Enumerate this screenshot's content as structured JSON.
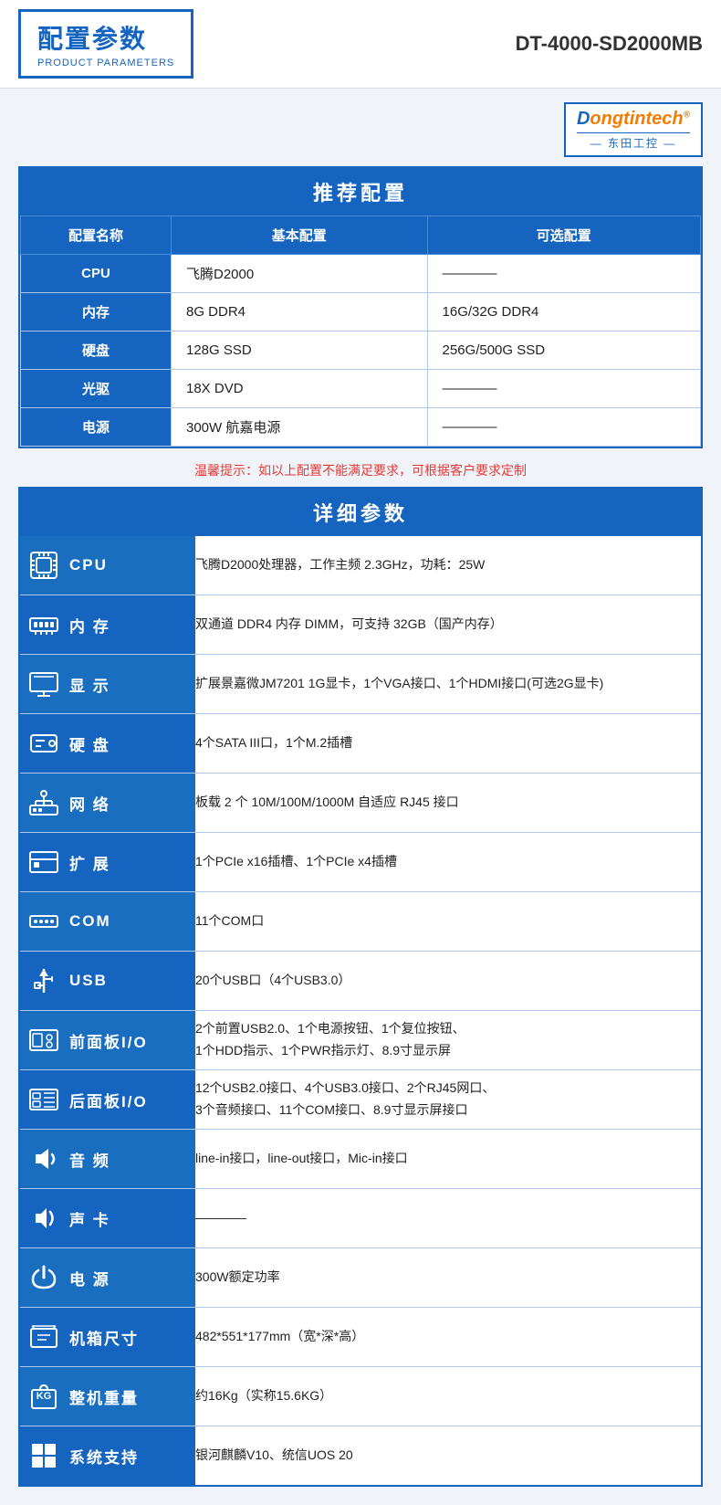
{
  "header": {
    "title_zh": "配置参数",
    "title_en": "PRODUCT PARAMETERS",
    "model": "DT-4000-SD2000MB"
  },
  "logo": {
    "line1_d": "D",
    "line1_rest": "ongtintech",
    "line1_reg": "®",
    "line2": "— 东田工控 —"
  },
  "recommend": {
    "section_title": "推荐配置",
    "col_name": "配置名称",
    "col_basic": "基本配置",
    "col_optional": "可选配置",
    "rows": [
      {
        "label": "CPU",
        "basic": "飞腾D2000",
        "optional": "————"
      },
      {
        "label": "内存",
        "basic": "8G DDR4",
        "optional": "16G/32G DDR4"
      },
      {
        "label": "硬盘",
        "basic": "128G SSD",
        "optional": "256G/500G SSD"
      },
      {
        "label": "光驱",
        "basic": "18X DVD",
        "optional": "————"
      },
      {
        "label": "电源",
        "basic": "300W 航嘉电源",
        "optional": "————"
      }
    ],
    "tip": "温馨提示：如以上配置不能满足要求，可根据客户要求定制"
  },
  "detail": {
    "section_title": "详细参数",
    "rows": [
      {
        "label": "CPU",
        "icon": "cpu-icon",
        "value": "飞腾D2000处理器，工作主频 2.3GHz，功耗：25W"
      },
      {
        "label": "内 存",
        "icon": "memory-icon",
        "value": "双通道 DDR4 内存 DIMM，可支持 32GB（国产内存）"
      },
      {
        "label": "显 示",
        "icon": "display-icon",
        "value": "扩展景嘉微JM7201 1G显卡，1个VGA接口、1个HDMI接口(可选2G显卡)"
      },
      {
        "label": "硬 盘",
        "icon": "harddisk-icon",
        "value": "4个SATA III口，1个M.2插槽"
      },
      {
        "label": "网 络",
        "icon": "network-icon",
        "value": "板载 2 个 10M/100M/1000M 自适应 RJ45 接口"
      },
      {
        "label": "扩 展",
        "icon": "expand-icon",
        "value": "1个PCIe x16插槽、1个PCIe x4插槽"
      },
      {
        "label": "COM",
        "icon": "com-icon",
        "value": "11个COM口"
      },
      {
        "label": "USB",
        "icon": "usb-icon",
        "value": "20个USB口（4个USB3.0）"
      },
      {
        "label": "前面板I/O",
        "icon": "frontpanel-icon",
        "value": "2个前置USB2.0、1个电源按钮、1个复位按钮、\n1个HDD指示、1个PWR指示灯、8.9寸显示屏"
      },
      {
        "label": "后面板I/O",
        "icon": "rearpanel-icon",
        "value": "12个USB2.0接口、4个USB3.0接口、2个RJ45网口、\n3个音频接口、11个COM接口、8.9寸显示屏接口"
      },
      {
        "label": "音 频",
        "icon": "audio-icon",
        "value": "line-in接口，line-out接口，Mic-in接口"
      },
      {
        "label": "声 卡",
        "icon": "soundcard-icon",
        "value": "————"
      },
      {
        "label": "电 源",
        "icon": "power-icon",
        "value": "300W额定功率"
      },
      {
        "label": "机箱尺寸",
        "icon": "chassis-icon",
        "value": "482*551*177mm（宽*深*高）"
      },
      {
        "label": "整机重量",
        "icon": "weight-icon",
        "value": "约16Kg（实称15.6KG）"
      },
      {
        "label": "系统支持",
        "icon": "os-icon",
        "value": "银河麒麟V10、统信UOS 20"
      }
    ]
  }
}
